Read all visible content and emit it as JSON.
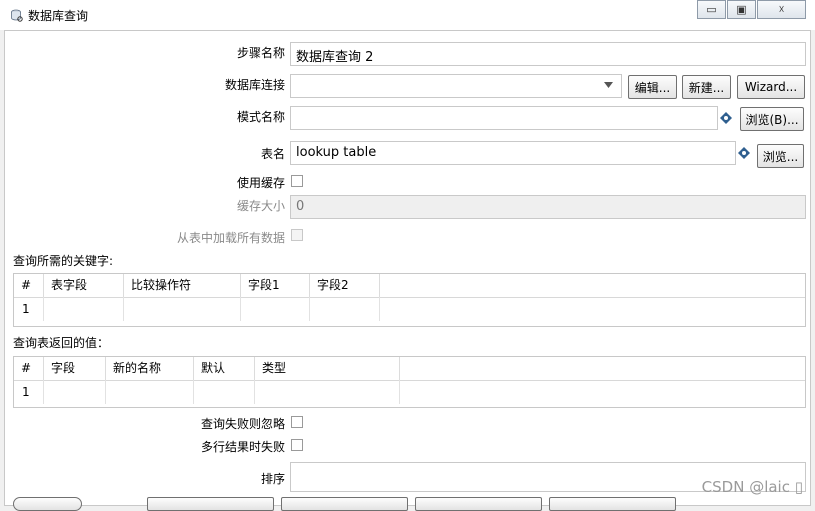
{
  "window": {
    "title": "数据库查询",
    "minimize_glyph": "▭",
    "maximize_glyph": "▣",
    "close_glyph": "☓"
  },
  "form": {
    "step_name": {
      "label": "步骤名称",
      "value": "数据库查询 2"
    },
    "connection": {
      "label": "数据库连接",
      "value": "",
      "edit_label": "编辑...",
      "new_label": "新建...",
      "wizard_label": "Wizard..."
    },
    "schema": {
      "label": "模式名称",
      "value": "",
      "browse_label": "浏览(B)..."
    },
    "table": {
      "label": "表名",
      "value": "lookup table",
      "browse_label": "浏览..."
    },
    "use_cache": {
      "label": "使用缓存",
      "checked": false
    },
    "cache_size": {
      "label": "缓存大小",
      "value": "0"
    },
    "load_all": {
      "label": "从表中加载所有数据",
      "checked": false
    }
  },
  "keys_section": {
    "title": "查询所需的关键字:",
    "columns": [
      "#",
      "表字段",
      "比较操作符",
      "字段1",
      "字段2"
    ],
    "rows": [
      [
        "1",
        "",
        "",
        "",
        ""
      ]
    ]
  },
  "return_section": {
    "title": "查询表返回的值：",
    "columns": [
      "#",
      "字段",
      "新的名称",
      "默认",
      "类型"
    ],
    "rows": [
      [
        "1",
        "",
        "",
        "",
        ""
      ]
    ]
  },
  "options": {
    "ignore_failure": {
      "label": "查询失败则忽略",
      "checked": false
    },
    "fail_multiple": {
      "label": "多行结果时失败",
      "checked": false
    },
    "order_by": {
      "label": "排序",
      "value": ""
    }
  },
  "watermark": "CSDN @laic ▯",
  "icons": [
    "database-icon",
    "variable-icon",
    "dropdown-arrow-icon"
  ]
}
